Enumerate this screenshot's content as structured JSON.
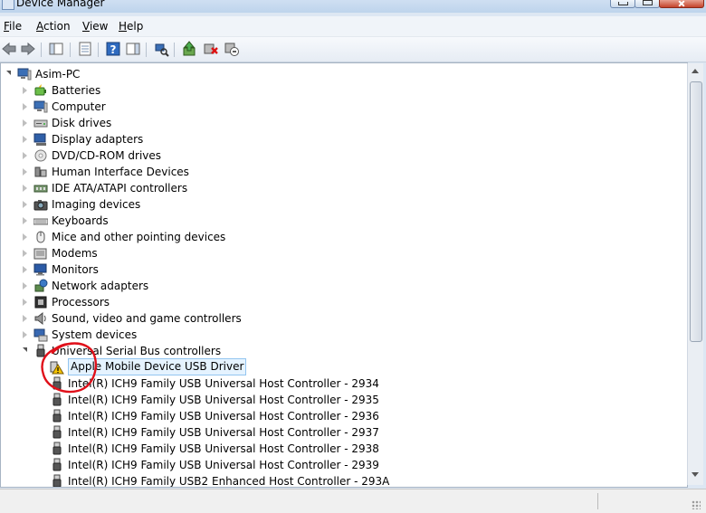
{
  "window": {
    "title": "Device Manager"
  },
  "menu": [
    {
      "label": "File",
      "mnemonic": "F",
      "rest": "ile"
    },
    {
      "label": "Action",
      "mnemonic": "A",
      "rest": "ction"
    },
    {
      "label": "View",
      "mnemonic": "V",
      "rest": "iew"
    },
    {
      "label": "Help",
      "mnemonic": "H",
      "rest": "elp"
    }
  ],
  "toolbar": [
    {
      "name": "back-arrow-icon"
    },
    {
      "name": "forward-arrow-icon"
    },
    {
      "name": "show-hide-console-tree-icon"
    },
    {
      "name": "properties-icon"
    },
    {
      "name": "help-icon"
    },
    {
      "name": "show-action-pane-icon"
    },
    {
      "name": "scan-hardware-changes-icon"
    },
    {
      "name": "update-driver-icon"
    },
    {
      "name": "uninstall-device-icon"
    },
    {
      "name": "disable-device-icon"
    }
  ],
  "tree": {
    "root": {
      "label": "Asim-PC",
      "icon": "computer-icon"
    },
    "categories": [
      {
        "label": "Batteries",
        "icon": "battery-icon"
      },
      {
        "label": "Computer",
        "icon": "computer-icon"
      },
      {
        "label": "Disk drives",
        "icon": "disk-drive-icon"
      },
      {
        "label": "Display adapters",
        "icon": "display-adapter-icon"
      },
      {
        "label": "DVD/CD-ROM drives",
        "icon": "dvd-drive-icon"
      },
      {
        "label": "Human Interface Devices",
        "icon": "hid-icon"
      },
      {
        "label": "IDE ATA/ATAPI controllers",
        "icon": "ide-controller-icon"
      },
      {
        "label": "Imaging devices",
        "icon": "camera-icon"
      },
      {
        "label": "Keyboards",
        "icon": "keyboard-icon"
      },
      {
        "label": "Mice and other pointing devices",
        "icon": "mouse-icon"
      },
      {
        "label": "Modems",
        "icon": "modem-icon"
      },
      {
        "label": "Monitors",
        "icon": "monitor-icon"
      },
      {
        "label": "Network adapters",
        "icon": "network-adapter-icon"
      },
      {
        "label": "Processors",
        "icon": "processor-icon"
      },
      {
        "label": "Sound, video and game controllers",
        "icon": "speaker-icon"
      },
      {
        "label": "System devices",
        "icon": "system-device-icon"
      },
      {
        "label": "Universal Serial Bus controllers",
        "icon": "usb-icon",
        "expanded": true
      }
    ],
    "usb_children": [
      {
        "label": "Apple Mobile Device USB Driver",
        "icon": "warning-icon",
        "selected": true
      },
      {
        "label": "Intel(R) ICH9 Family USB Universal Host Controller - 2934",
        "icon": "usb-plug-icon"
      },
      {
        "label": "Intel(R) ICH9 Family USB Universal Host Controller - 2935",
        "icon": "usb-plug-icon"
      },
      {
        "label": "Intel(R) ICH9 Family USB Universal Host Controller - 2936",
        "icon": "usb-plug-icon"
      },
      {
        "label": "Intel(R) ICH9 Family USB Universal Host Controller - 2937",
        "icon": "usb-plug-icon"
      },
      {
        "label": "Intel(R) ICH9 Family USB Universal Host Controller - 2938",
        "icon": "usb-plug-icon"
      },
      {
        "label": "Intel(R) ICH9 Family USB Universal Host Controller - 2939",
        "icon": "usb-plug-icon"
      },
      {
        "label": "Intel(R) ICH9 Family USB2 Enhanced Host Controller - 293A",
        "icon": "usb-plug-icon"
      }
    ]
  },
  "colors": {
    "selection_bg": "#e5f3ff",
    "selection_border": "#93c5f0",
    "annotation_circle": "#e0101a",
    "warning": "#f5c400"
  }
}
